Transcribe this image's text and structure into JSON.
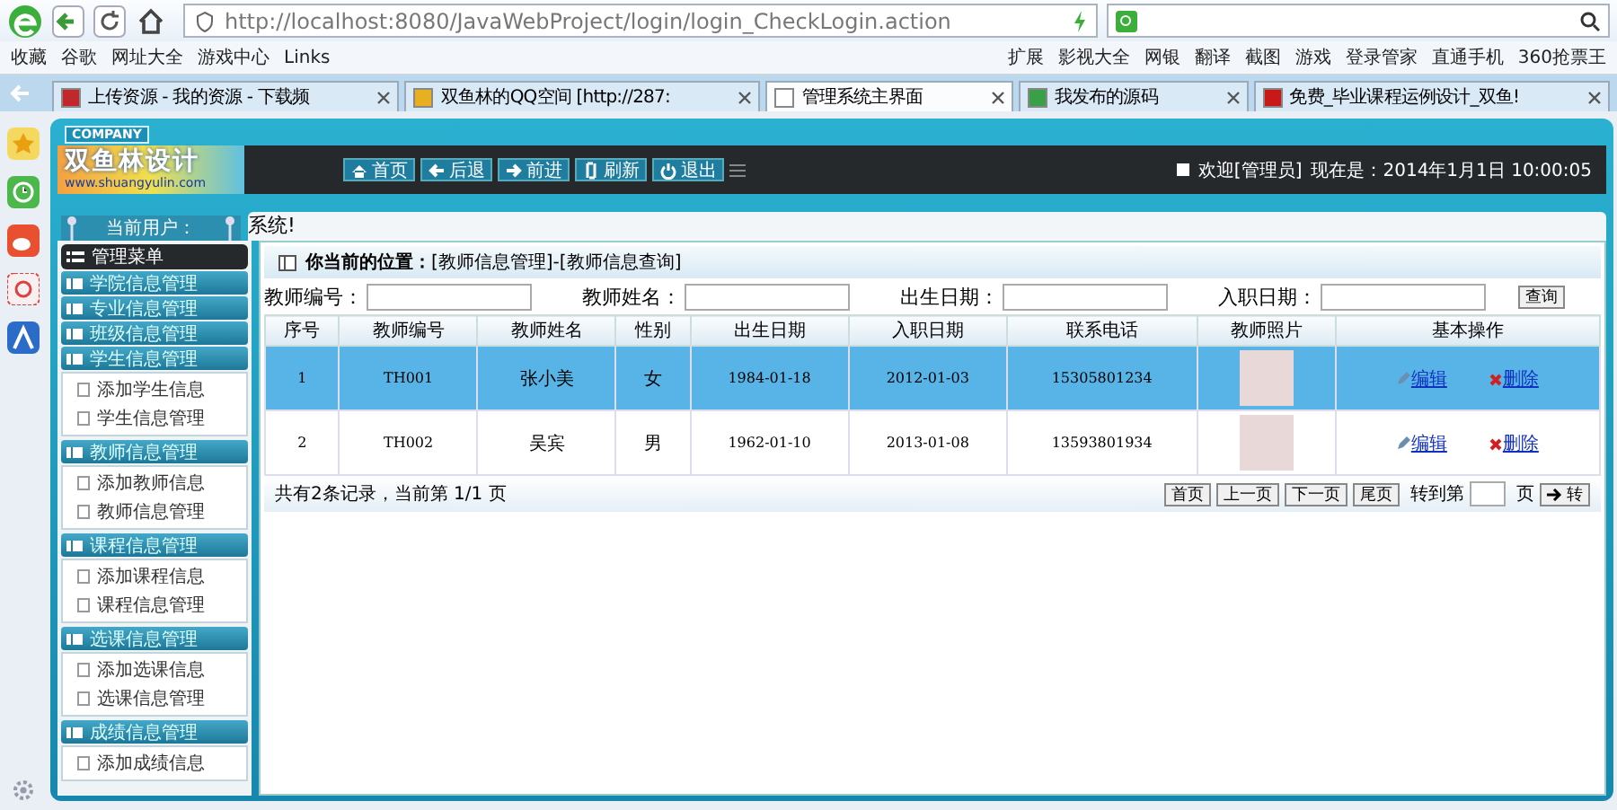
{
  "browser": {
    "address": "http://localhost:8080/JavaWebProject/login/login_CheckLogin.action",
    "bookmarks": [
      "收藏",
      "谷歌",
      "网址大全",
      "游戏中心",
      "Links"
    ],
    "extensions": [
      "扩展",
      "影视大全",
      "网银",
      "翻译",
      "截图",
      "游戏",
      "登录管家",
      "直通手机",
      "360抢票王"
    ],
    "tabs": [
      {
        "label": "上传资源 - 我的资源 - 下载频",
        "selected": false,
        "color": "#c0282d"
      },
      {
        "label": "双鱼林的QQ空间 [http://287:",
        "selected": false,
        "color": "#e8b020"
      },
      {
        "label": "管理系统主界面",
        "selected": true,
        "color": "#ffffff"
      },
      {
        "label": "我发布的源码",
        "selected": false,
        "color": "#3aa048"
      },
      {
        "label": "免费_毕业课程运例设计_双鱼!",
        "selected": false,
        "color": "#c81818"
      }
    ]
  },
  "app": {
    "company": "COMPANY",
    "logo": "双鱼林设计",
    "logo_url": "www.shuangyulin.com",
    "nav": [
      "首页",
      "后退",
      "前进",
      "刷新",
      "退出"
    ],
    "welcome": "欢迎[管理员]",
    "time": "现在是：2014年1月1日 10:00:05",
    "user_label": "当前用户：",
    "marquee": "系统!"
  },
  "sidebar": {
    "title": "管理菜单",
    "groups": [
      {
        "label": "学院信息管理"
      },
      {
        "label": "专业信息管理"
      },
      {
        "label": "班级信息管理"
      },
      {
        "label": "学生信息管理",
        "children": [
          "添加学生信息",
          "学生信息管理"
        ]
      },
      {
        "label": "教师信息管理",
        "children": [
          "添加教师信息",
          "教师信息管理"
        ]
      },
      {
        "label": "课程信息管理",
        "children": [
          "添加课程信息",
          "课程信息管理"
        ]
      },
      {
        "label": "选课信息管理",
        "children": [
          "添加选课信息",
          "选课信息管理"
        ]
      },
      {
        "label": "成绩信息管理",
        "children": [
          "添加成绩信息"
        ]
      }
    ]
  },
  "main": {
    "breadcrumb": "**你当前的位置：**[教师信息管理]-[教师信息查询]",
    "filters": [
      {
        "label": "教师编号："
      },
      {
        "label": "教师姓名："
      },
      {
        "label": "出生日期："
      },
      {
        "label": "入职日期："
      }
    ],
    "search_button": "查询",
    "table": {
      "columns": [
        "序号",
        "教师编号",
        "教师姓名",
        "性别",
        "出生日期",
        "入职日期",
        "联系电话",
        "教师照片",
        "基本操作"
      ],
      "rows": [
        {
          "selected": true,
          "cells": [
            "1",
            "TH001",
            "张小美",
            "女",
            "1984-01-18",
            "2012-01-03",
            "15305801234"
          ],
          "edit": "编辑",
          "delete": "删除"
        },
        {
          "selected": false,
          "cells": [
            "2",
            "TH002",
            "吴宾",
            "男",
            "1962-01-10",
            "2013-01-08",
            "13593801934"
          ],
          "edit": "编辑",
          "delete": "删除"
        }
      ]
    },
    "summary": "共有2条记录，当前第 1/1 页",
    "pager": [
      "首页",
      "上一页",
      "下一页",
      "尾页"
    ],
    "goto_label": "转到第",
    "goto_unit": "页",
    "goto_button": "转"
  }
}
